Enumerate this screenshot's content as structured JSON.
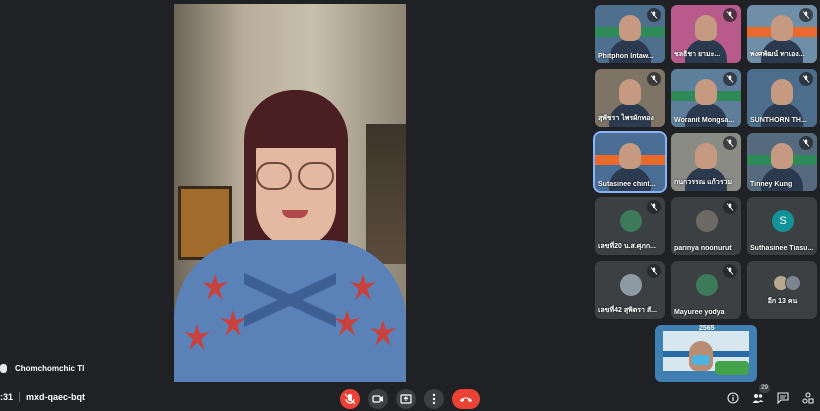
{
  "main_speaker": {
    "name": "Chomchomchic Tl"
  },
  "meeting": {
    "time": ":31",
    "code": "mxd-qaec-bqt"
  },
  "participants": [
    {
      "label": "Phitphon Intaw...",
      "type": "video",
      "muted": true
    },
    {
      "label": "ชลธิชา ยามะ...",
      "type": "video",
      "muted": true
    },
    {
      "label": "พงศพัฒน์ ทาเอง...",
      "type": "video",
      "muted": true
    },
    {
      "label": "สุพัชรา ไพรผักทอง",
      "type": "video",
      "muted": true
    },
    {
      "label": "Woranit Mongsa...",
      "type": "video",
      "muted": true
    },
    {
      "label": "SUNTHORN TH...",
      "type": "video",
      "muted": true
    },
    {
      "label": "Sutasinee chint...",
      "type": "video",
      "muted": false,
      "active": true
    },
    {
      "label": "กนกวรรณ แก้วรวม",
      "type": "video",
      "muted": true
    },
    {
      "label": "Tinney Kung",
      "type": "video",
      "muted": true
    },
    {
      "label": "เลขที่20 น.ส.ศุภก...",
      "type": "avatar",
      "muted": true
    },
    {
      "label": "parinya noonurut",
      "type": "avatar",
      "muted": true
    },
    {
      "label": "Suthasinee Tiasu...",
      "type": "letter",
      "letter": "S",
      "muted": false
    },
    {
      "label": "เลขที่42 สุพิตรา สั...",
      "type": "avatar",
      "muted": true
    },
    {
      "label": "Mayuree yodya",
      "type": "avatar",
      "muted": true
    },
    {
      "label": "อีก 13 คน",
      "type": "more",
      "muted": false
    }
  ],
  "self_tile": {
    "banner_text": "2565"
  },
  "controls": {
    "mic_icon": "mic-off-icon",
    "camera_icon": "camera-icon",
    "present_icon": "present-icon",
    "more_icon": "more-vert-icon",
    "end_icon": "end-call-icon"
  },
  "right_controls": {
    "people_count": "29"
  },
  "colors": {
    "background": "#202124",
    "end_call": "#ea4335",
    "active_outline": "#8ab4f8"
  }
}
